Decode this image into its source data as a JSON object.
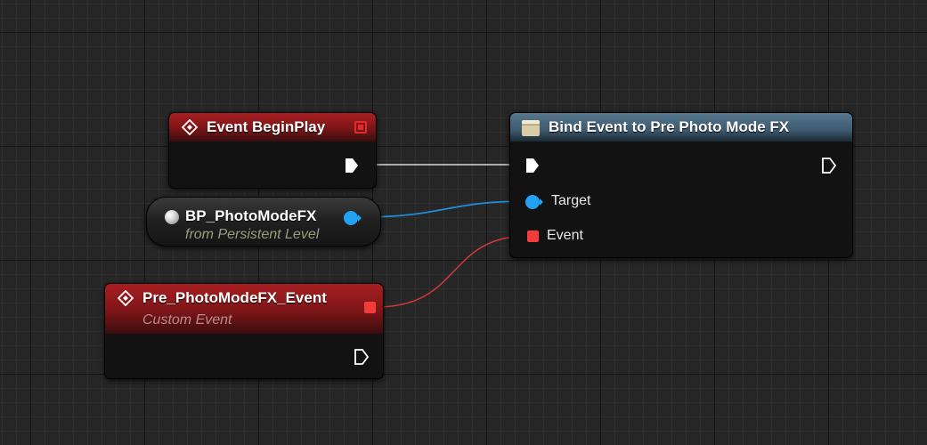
{
  "graph": {
    "nodes": {
      "begin_play": {
        "title": "Event BeginPlay",
        "icon": "event-diamond-icon",
        "header_color": "#8f1a1c"
      },
      "photo_mode_ref": {
        "title": "BP_PhotoModeFX",
        "subtitle": "from Persistent Level",
        "icon": "sphere-icon"
      },
      "custom_event": {
        "title": "Pre_PhotoModeFX_Event",
        "subtitle": "Custom Event",
        "icon": "event-diamond-icon",
        "header_color": "#8f1a1c"
      },
      "bind_event": {
        "title": "Bind Event to Pre Photo Mode FX",
        "icon": "function-icon",
        "header_color": "#4a6a80",
        "pins": {
          "target_label": "Target",
          "event_label": "Event"
        }
      }
    },
    "colors": {
      "exec_wire": "#d8d8d8",
      "object_wire": "#1e8fd6",
      "delegate_wire": "#d43a3a",
      "object_pin": "#22a2f2",
      "delegate_pin": "#f23b3b"
    }
  }
}
